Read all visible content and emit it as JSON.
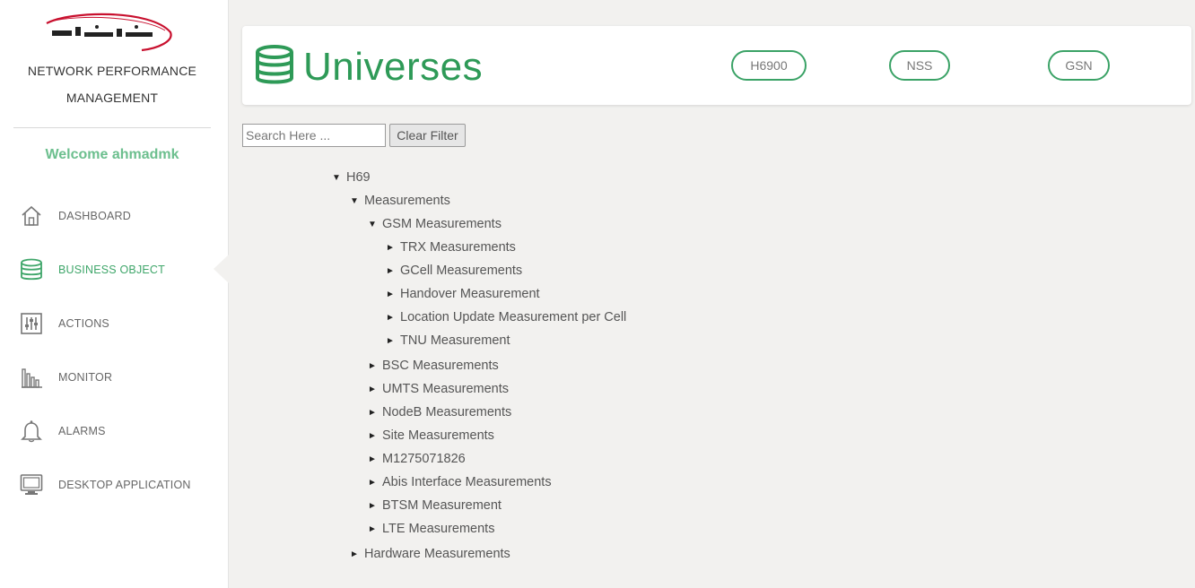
{
  "sidebar": {
    "brand_line1": "NETWORK PERFORMANCE",
    "brand_line2": "MANAGEMENT",
    "welcome": "Welcome ahmadmk",
    "items": [
      {
        "label": "DASHBOARD",
        "icon": "home-icon",
        "active": false
      },
      {
        "label": "BUSINESS OBJECT",
        "icon": "database-icon",
        "active": true
      },
      {
        "label": "ACTIONS",
        "icon": "sliders-icon",
        "active": false
      },
      {
        "label": "MONITOR",
        "icon": "bar-chart-icon",
        "active": false
      },
      {
        "label": "ALARMS",
        "icon": "bell-icon",
        "active": false
      },
      {
        "label": "DESKTOP APPLICATION",
        "icon": "monitor-icon",
        "active": false
      }
    ]
  },
  "header": {
    "title": "Universes",
    "buttons": [
      "H6900",
      "NSS",
      "GSN"
    ]
  },
  "filter": {
    "placeholder": "Search Here ...",
    "value": "",
    "clear_label": "Clear Filter"
  },
  "tree": [
    {
      "label": "H69",
      "level": 0,
      "expanded": true
    },
    {
      "label": "Measurements",
      "level": 1,
      "expanded": true
    },
    {
      "label": "GSM Measurements",
      "level": 2,
      "expanded": true
    },
    {
      "label": "TRX Measurements",
      "level": 3,
      "expanded": false
    },
    {
      "label": "GCell Measurements",
      "level": 3,
      "expanded": false
    },
    {
      "label": "Handover Measurement",
      "level": 3,
      "expanded": false
    },
    {
      "label": "Location Update Measurement per Cell",
      "level": 3,
      "expanded": false
    },
    {
      "label": "TNU Measurement",
      "level": 3,
      "expanded": false
    },
    {
      "label": "BSC Measurements",
      "level": 2,
      "expanded": false
    },
    {
      "label": "UMTS Measurements",
      "level": 2,
      "expanded": false
    },
    {
      "label": "NodeB Measurements",
      "level": 2,
      "expanded": false
    },
    {
      "label": "Site Measurements",
      "level": 2,
      "expanded": false
    },
    {
      "label": "M1275071826",
      "level": 2,
      "expanded": false
    },
    {
      "label": "Abis Interface Measurements",
      "level": 2,
      "expanded": false
    },
    {
      "label": "BTSM Measurement",
      "level": 2,
      "expanded": false
    },
    {
      "label": "LTE Measurements",
      "level": 2,
      "expanded": false
    },
    {
      "label": "Hardware Measurements",
      "level": 1,
      "expanded": false
    }
  ],
  "colors": {
    "accent": "#2e9a57",
    "accent_light": "#6cbf8e",
    "logo_red": "#c8102e"
  }
}
